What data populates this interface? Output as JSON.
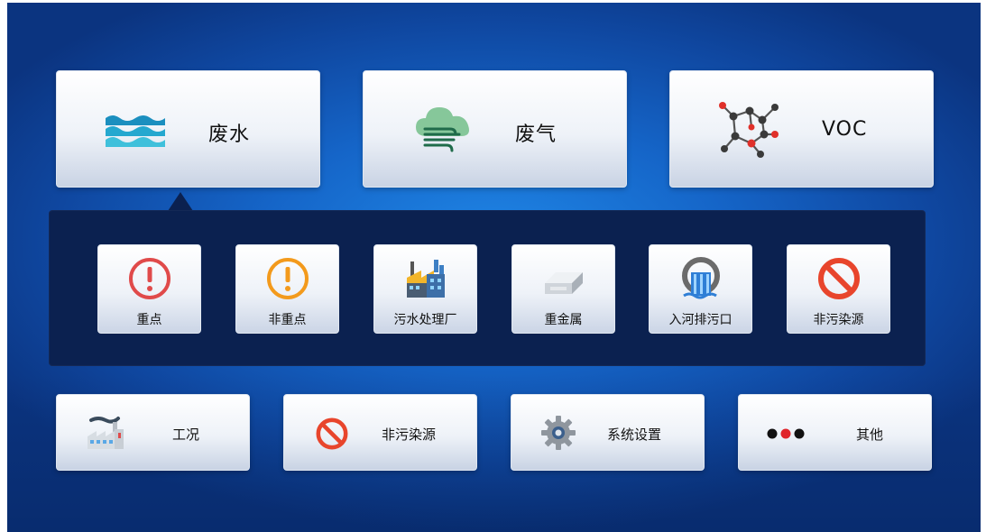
{
  "categories": [
    {
      "id": "wastewater",
      "label": "废水",
      "icon": "water-waves-icon"
    },
    {
      "id": "wastegas",
      "label": "废气",
      "icon": "cloud-wind-icon"
    },
    {
      "id": "voc",
      "label": "VOC",
      "icon": "molecule-icon"
    }
  ],
  "selected_category": "废水",
  "subcategories": [
    {
      "label": "重点",
      "icon": "red-alert-icon"
    },
    {
      "label": "非重点",
      "icon": "orange-alert-icon"
    },
    {
      "label": "污水处理厂",
      "icon": "factory-icon"
    },
    {
      "label": "重金属",
      "icon": "metal-bar-icon"
    },
    {
      "label": "入河排污口",
      "icon": "river-outlet-icon"
    },
    {
      "label": "非污染源",
      "icon": "prohibited-icon"
    }
  ],
  "bottom": [
    {
      "label": "工况",
      "icon": "factory-condition-icon"
    },
    {
      "label": "非污染源",
      "icon": "prohibited-icon"
    },
    {
      "label": "系统设置",
      "icon": "gear-icon"
    },
    {
      "label": "其他",
      "icon": "three-dots-icon"
    }
  ],
  "colors": {
    "alert_red": "#e04a4a",
    "alert_orange": "#f39a1c",
    "water_teal": "#1fa3c8",
    "cloud_green": "#7dbe8f",
    "prohibit_red": "#e8452c",
    "panel": "#0b2150"
  }
}
